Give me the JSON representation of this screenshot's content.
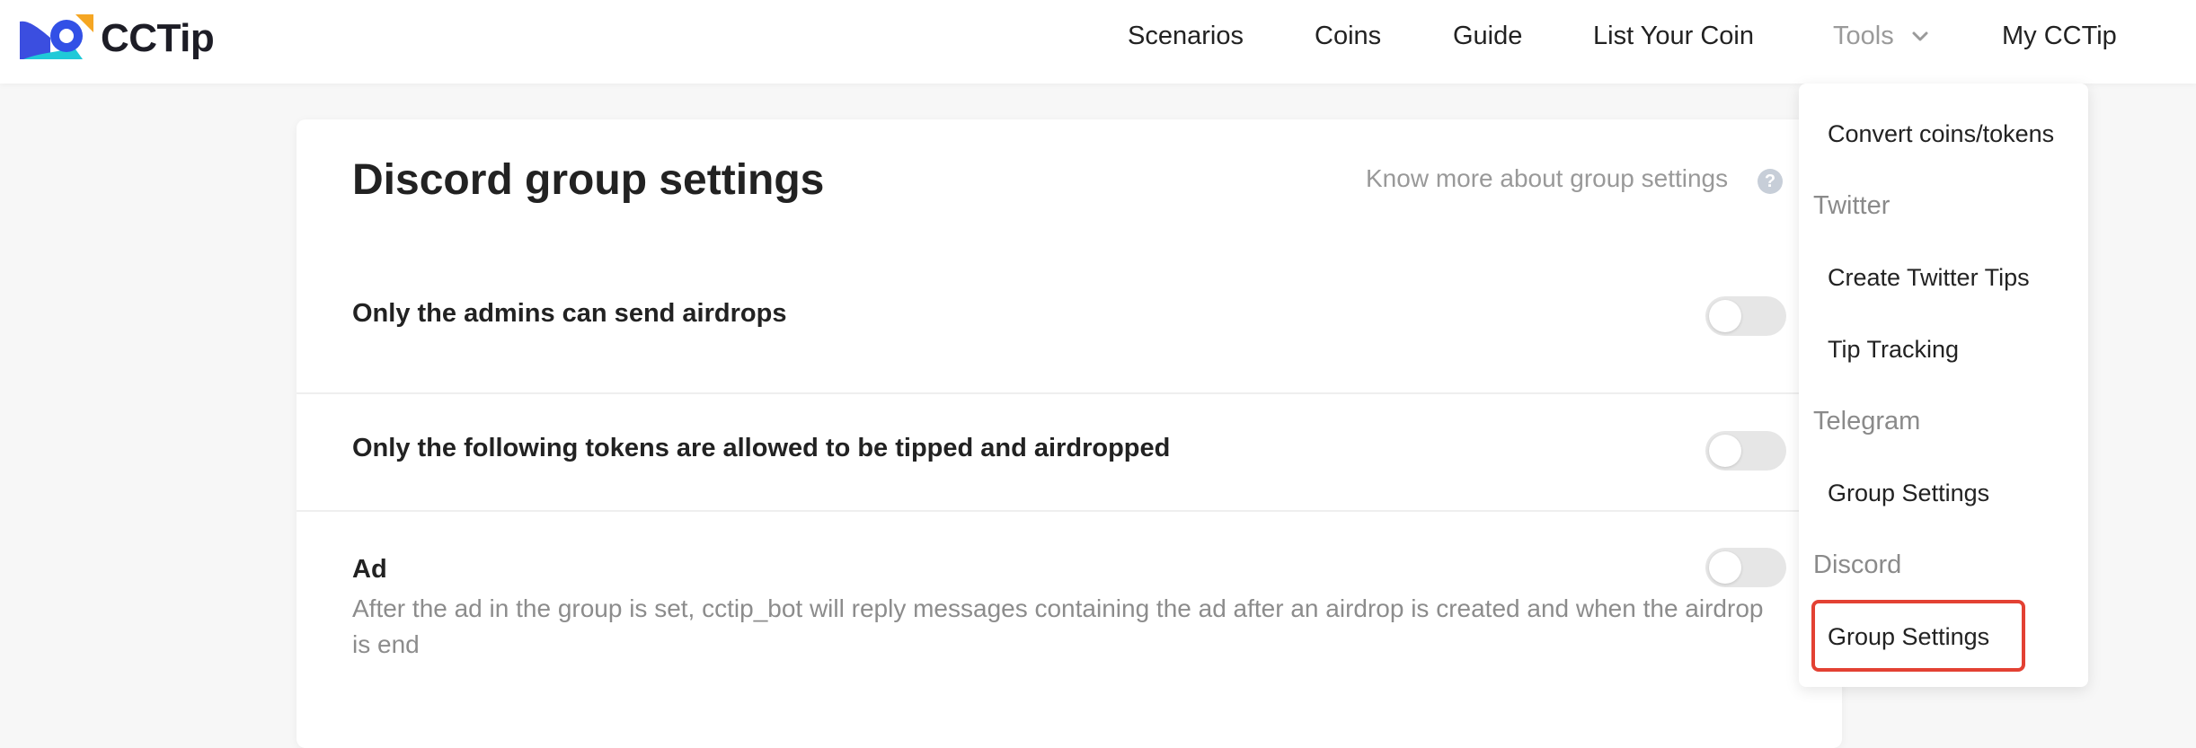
{
  "brand": {
    "name": "CCTip"
  },
  "nav": {
    "items": [
      {
        "label": "Scenarios"
      },
      {
        "label": "Coins"
      },
      {
        "label": "Guide"
      },
      {
        "label": "List Your Coin"
      },
      {
        "label": "Tools"
      },
      {
        "label": "My CCTip"
      }
    ]
  },
  "page": {
    "title": "Discord group settings",
    "help_link": "Know more about group settings",
    "help_icon": "?"
  },
  "settings": [
    {
      "label": "Only the admins can send airdrops",
      "enabled": false
    },
    {
      "label": "Only the following tokens are allowed to be tipped and airdropped",
      "enabled": false
    },
    {
      "label": "Ad",
      "enabled": false,
      "description": "After the ad in the group is set, cctip_bot will reply messages containing the ad after an airdrop is created and when the airdrop is end"
    }
  ],
  "dropdown": {
    "convert": "Convert coins/tokens",
    "twitter_group": "Twitter",
    "twitter_items": [
      "Create Twitter Tips",
      "Tip Tracking"
    ],
    "telegram_group": "Telegram",
    "telegram_items": [
      "Group Settings"
    ],
    "discord_group": "Discord",
    "discord_items": [
      "Group Settings"
    ]
  },
  "colors": {
    "highlight": "#e34133",
    "toggle_off": "#e6e6e6",
    "muted_text": "#9a9a9a"
  }
}
